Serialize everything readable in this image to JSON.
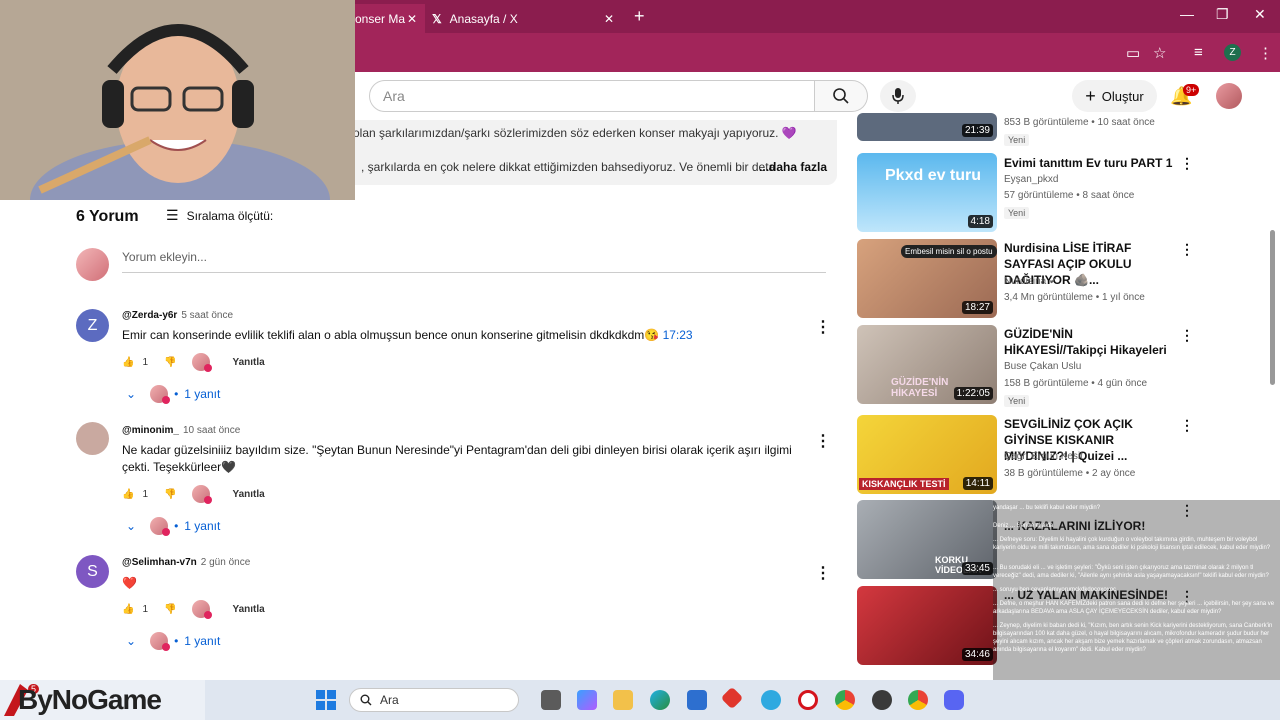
{
  "browser": {
    "tabs": [
      {
        "label": "onser Ma"
      },
      {
        "label": "Anasayfa / X"
      }
    ],
    "profile_letter": "Z"
  },
  "header": {
    "search_placeholder": "Ara",
    "create_label": "Oluştur",
    "notifications_badge": "9+"
  },
  "description": {
    "line1": "olan şarkılarımızdan/şarkı sözlerimizden söz ederken konser makyajı yapıyoruz. 💜",
    "line2": ", şarkılarda en çok nelere dikkat ettiğimizden bahsediyoruz. Ve önemli bir deta",
    "more": "...daha fazla"
  },
  "comments": {
    "count_label": "6 Yorum",
    "sort_label": "Sıralama ölçütü:",
    "add_placeholder": "Yorum ekleyin...",
    "items": [
      {
        "avatar_letter": "Z",
        "avatar_color": "#5c6bc0",
        "handle": "@Zerda-y6r",
        "time": "5 saat önce",
        "text": "Emir can konserinde evlilik teklifi alan o abla olmuşsun bence onun konserine gitmelisin dkdkdkdm😘",
        "timestamp": "17:23",
        "likes": "1",
        "reply_label": "Yanıtla",
        "replies": "1 yanıt"
      },
      {
        "avatar_letter": "",
        "avatar_color": "#c9a9a0",
        "handle": "@minonim_",
        "time": "10 saat önce",
        "text": "Ne kadar güzelsiniiiz bayıldım size. \"Şeytan Bunun Neresinde\"yi Pentagram'dan deli gibi dinleyen birisi olarak içerik aşırı ilgimi çekti. Teşekkürleer🖤",
        "timestamp": "",
        "likes": "1",
        "reply_label": "Yanıtla",
        "replies": "1 yanıt"
      },
      {
        "avatar_letter": "S",
        "avatar_color": "#7e57c2",
        "handle": "@Selimhan-v7n",
        "time": "2 gün önce",
        "text": "❤️",
        "timestamp": "",
        "likes": "1",
        "reply_label": "Yanıtla",
        "replies": "1 yanıt"
      }
    ]
  },
  "sidebar": {
    "videos": [
      {
        "title": "",
        "channel": "",
        "meta": "853 B görüntüleme • 10 saat önce",
        "badge": "Yeni",
        "duration": "21:39",
        "thumb_color": "#5d6a7d"
      },
      {
        "title": "Evimi tanıttım Ev turu PART 1",
        "channel": "Eyşan_pkxd",
        "meta": "57 görüntüleme • 8 saat önce",
        "badge": "Yeni",
        "duration": "4:18",
        "thumb_color": "#6ec3f2",
        "thumb_text": "Pkxd ev turu"
      },
      {
        "title": "Nurdisina LİSE İTİRAF SAYFASI AÇIP OKULU DAĞITIYOR 🪨...",
        "channel": "Nurdisina ✔",
        "meta": "3,4 Mn görüntüleme • 1 yıl önce",
        "badge": "",
        "duration": "18:27",
        "thumb_color": "#c88a6a",
        "thumb_text": "Embesil misin sil o postu"
      },
      {
        "title": "GÜZİDE'NİN HİKAYESİ//Takipçi Hikayeleri",
        "channel": "Buse Çakan Uslu",
        "meta": "158 B görüntüleme • 4 gün önce",
        "badge": "Yeni",
        "duration": "1:22:05",
        "thumb_color": "#b4a69a",
        "thumb_text": "GÜZİDE'NİN HİKAYESİ"
      },
      {
        "title": "SEVGİLİNİZ ÇOK AÇIK GİYİNSE KISKANIR MIYDINIZ?! | Quizei ...",
        "channel": "Çağrı Ergün Kesit",
        "meta": "38 B görüntüleme • 2 ay önce",
        "badge": "",
        "duration": "14:11",
        "thumb_color": "#f2d33a",
        "thumb_text": "KISKANÇLIK TESTİ"
      },
      {
        "title": "... KAZALARINI İZLİYOR!",
        "channel": "",
        "meta": "",
        "badge": "",
        "duration": "33:45",
        "thumb_color": "#8a8f96",
        "thumb_text": "KORKU VİDEOLAR"
      },
      {
        "title": "... UZ YALAN MAKİNESİNDE!",
        "channel": "",
        "meta": "",
        "badge": "",
        "duration": "34:46",
        "thumb_color": "#b8232c",
        "thumb_text": ""
      }
    ]
  },
  "chat_overlay": {
    "lines": [
      "yandaşar ... bu teklifi kabul eder miydin?",
      "Deniz ... Şeritte el alda",
      "... Defneye soru: Diyelim ki hayalini çok kurduğun o voleybol takımına girdin, muhteşem bir voleybol kariyerin oldu ve milli takımdasın, ama sana dediler ki psikoloji lisansın iptal edilecek, kabul eder miydin?",
      "... Bu sorudaki eli ... ve işletim şeyleri: \"Öykü seni işten çıkarıyoruz ama tazminat olarak 2 milyon tl vereceğiz\" dedi, ama dediler ki, \"Ailenle aynı şehirde asla yaşayamayacaksın!\" teklifi kabul eder miydin?",
      "... soruyu ben cevaplamıyorumckdkdocoxoxoc",
      "... Defne, o meşhur HAN KAFEMİZdeki patron sana dedi ki defne her şeyleri ... içebilirsin, her şey sana ve arkadaşlarına BEDAVA ama ASLA ÇAY İÇEMEYECEKSİN dediler, kabul eder miydin?",
      "... Zeynep, diyelim ki baban dedi ki, \"Kızım, ben artık senin Kick kariyerini destekliyorum, sana Canberk'in bilgisayarından 100 kat daha güzel, o hayal bilgisayarını alıcam, mikrofondur kameradır şudur budur her şeyini alıcam kızım, ancak her akşam bize yemek hazırlamak ve çöpleri atmak zorundasın, atmazsan anında bilgisayarına el koyarım\" dedi. Kabul eder miydin?"
    ]
  },
  "taskbar": {
    "search_label": "Ara",
    "brand_text": "ByNoGame",
    "notification_count": "5"
  }
}
